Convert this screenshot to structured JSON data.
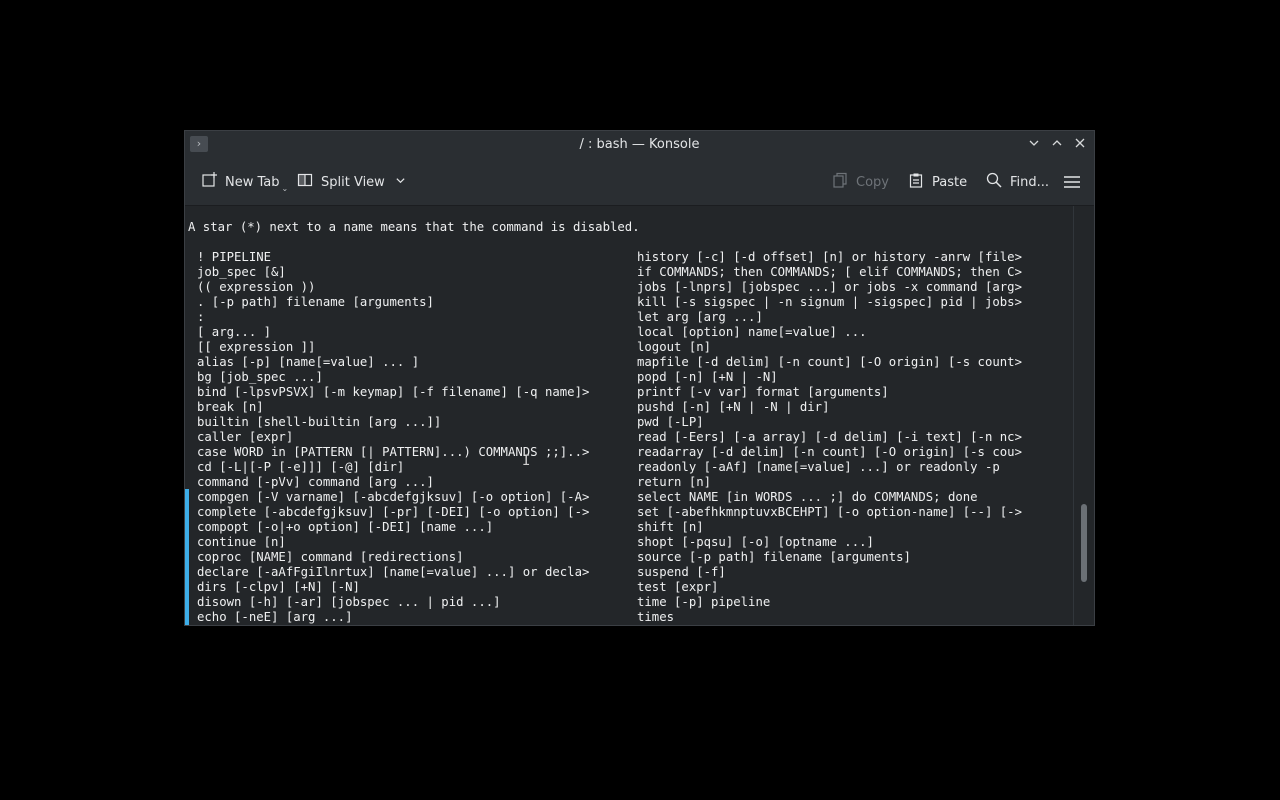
{
  "window": {
    "title": "/ : bash — Konsole",
    "menu_icon": "chevron-right-icon",
    "controls": {
      "minimize_icon": "chevron-down-icon",
      "maximize_icon": "chevron-up-icon",
      "close_icon": "close-icon"
    }
  },
  "toolbar": {
    "new_tab": "New Tab",
    "split_view": "Split View",
    "copy": "Copy",
    "paste": "Paste",
    "find": "Find...",
    "menu_icon": "hamburger-menu-icon"
  },
  "terminal": {
    "header": "A star (*) next to a name means that the command is disabled.",
    "left_column": [
      "! PIPELINE",
      "job_spec [&]",
      "(( expression ))",
      ". [-p path] filename [arguments]",
      ":",
      "[ arg... ]",
      "[[ expression ]]",
      "alias [-p] [name[=value] ... ]",
      "bg [job_spec ...]",
      "bind [-lpsvPSVX] [-m keymap] [-f filename] [-q name]>",
      "break [n]",
      "builtin [shell-builtin [arg ...]]",
      "caller [expr]",
      "case WORD in [PATTERN [| PATTERN]...) COMMANDS ;;]..>",
      "cd [-L|[-P [-e]]] [-@] [dir]",
      "command [-pVv] command [arg ...]",
      "compgen [-V varname] [-abcdefgjksuv] [-o option] [-A>",
      "complete [-abcdefgjksuv] [-pr] [-DEI] [-o option] [->",
      "compopt [-o|+o option] [-DEI] [name ...]",
      "continue [n]",
      "coproc [NAME] command [redirections]",
      "declare [-aAfFgiIlnrtux] [name[=value] ...] or decla>",
      "dirs [-clpv] [+N] [-N]",
      "disown [-h] [-ar] [jobspec ... | pid ...]",
      "echo [-neE] [arg ...]"
    ],
    "right_column": [
      "history [-c] [-d offset] [n] or history -anrw [file>",
      "if COMMANDS; then COMMANDS; [ elif COMMANDS; then C>",
      "jobs [-lnprs] [jobspec ...] or jobs -x command [arg>",
      "kill [-s sigspec | -n signum | -sigspec] pid | jobs>",
      "let arg [arg ...]",
      "local [option] name[=value] ...",
      "logout [n]",
      "mapfile [-d delim] [-n count] [-O origin] [-s count>",
      "popd [-n] [+N | -N]",
      "printf [-v var] format [arguments]",
      "pushd [-n] [+N | -N | dir]",
      "pwd [-LP]",
      "read [-Eers] [-a array] [-d delim] [-i text] [-n nc>",
      "readarray [-d delim] [-n count] [-O origin] [-s cou>",
      "readonly [-aAf] [name[=value] ...] or readonly -p",
      "return [n]",
      "select NAME [in WORDS ... ;] do COMMANDS; done",
      "set [-abefhkmnptuvxBCEHPT] [-o option-name] [--] [->",
      "shift [n]",
      "shopt [-pqsu] [-o] [optname ...]",
      "source [-p path] filename [arguments]",
      "suspend [-f]",
      "test [expr]",
      "time [-p] pipeline",
      "times"
    ]
  },
  "colors": {
    "background": "#000000",
    "terminal_bg": "#232629",
    "text": "#eff0f1",
    "accent": "#3daee9"
  }
}
